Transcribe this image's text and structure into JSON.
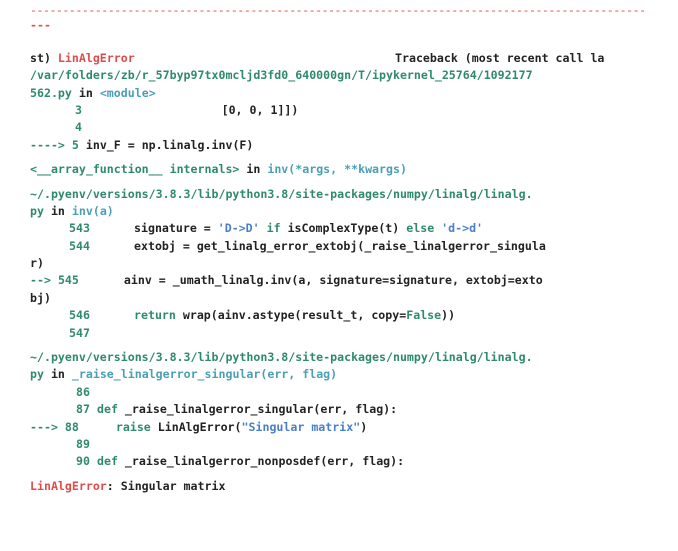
{
  "separator": "-----------------------------------------------------------------------------------------------",
  "separator_tail": "---",
  "header": {
    "error_name": "LinAlgError",
    "traceback_title_a": "Traceback (most recent call la",
    "traceback_title_b": "st)"
  },
  "frames": [
    {
      "path_a": "/var/folders/zb/r_57byp97tx0mcljd3fd0_640000gn/T/ipykernel_25764/1092177",
      "path_b": "562.py",
      "in_word": "in",
      "func": "<module>",
      "lines": [
        {
          "no": "3",
          "code": "                    [0, 0, 1]])"
        },
        {
          "no": "4",
          "code": ""
        },
        {
          "arrow": "---->",
          "no": "5",
          "code": "inv_F = np.linalg.inv(F)"
        }
      ]
    },
    {
      "internals": "<__array_function__ internals>",
      "in_word": "in",
      "func": "inv(*args, **kwargs)"
    },
    {
      "path_a": "~/.pyenv/versions/3.8.3/lib/python3.8/site-packages/numpy/linalg/linalg.",
      "path_b": "py",
      "in_word": "in",
      "func": "inv(a)",
      "lines": [
        {
          "no": "543",
          "code_pre": "signature = ",
          "str1": "'D->D'",
          "kw1": " if ",
          "code_mid": "isComplexType(t) ",
          "kw2": "else",
          "str2": " 'd->d'"
        },
        {
          "no": "544",
          "code": "extobj = get_linalg_error_extobj(_raise_linalgerror_singula"
        },
        {
          "wrap": "r)"
        },
        {
          "arrow": "-->",
          "no": "545",
          "code": "ainv = _umath_linalg.inv(a, signature=signature, extobj=exto"
        },
        {
          "wrap": "bj)"
        },
        {
          "no": "546",
          "kw": "return",
          "code": " wrap(ainv.astype(result_t, copy=",
          "kwval": "False",
          "tail": "))"
        },
        {
          "no": "547",
          "code": ""
        }
      ]
    },
    {
      "path_a": "~/.pyenv/versions/3.8.3/lib/python3.8/site-packages/numpy/linalg/linalg.",
      "path_b": "py",
      "in_word": "in",
      "func": "_raise_linalgerror_singular(err, flag)",
      "lines": [
        {
          "no": "86",
          "code": ""
        },
        {
          "no": "87",
          "kw": "def",
          "code": " _raise_linalgerror_singular(err, flag):"
        },
        {
          "arrow": "--->",
          "no": "88",
          "kw": "raise",
          "code": " LinAlgError(",
          "str": "\"Singular matrix\"",
          "tail": ")"
        },
        {
          "no": "89",
          "code": ""
        },
        {
          "no": "90",
          "kw": "def",
          "code": " _raise_linalgerror_nonposdef(err, flag):"
        }
      ]
    }
  ],
  "final": {
    "error_name": "LinAlgError",
    "message": ": Singular matrix"
  }
}
